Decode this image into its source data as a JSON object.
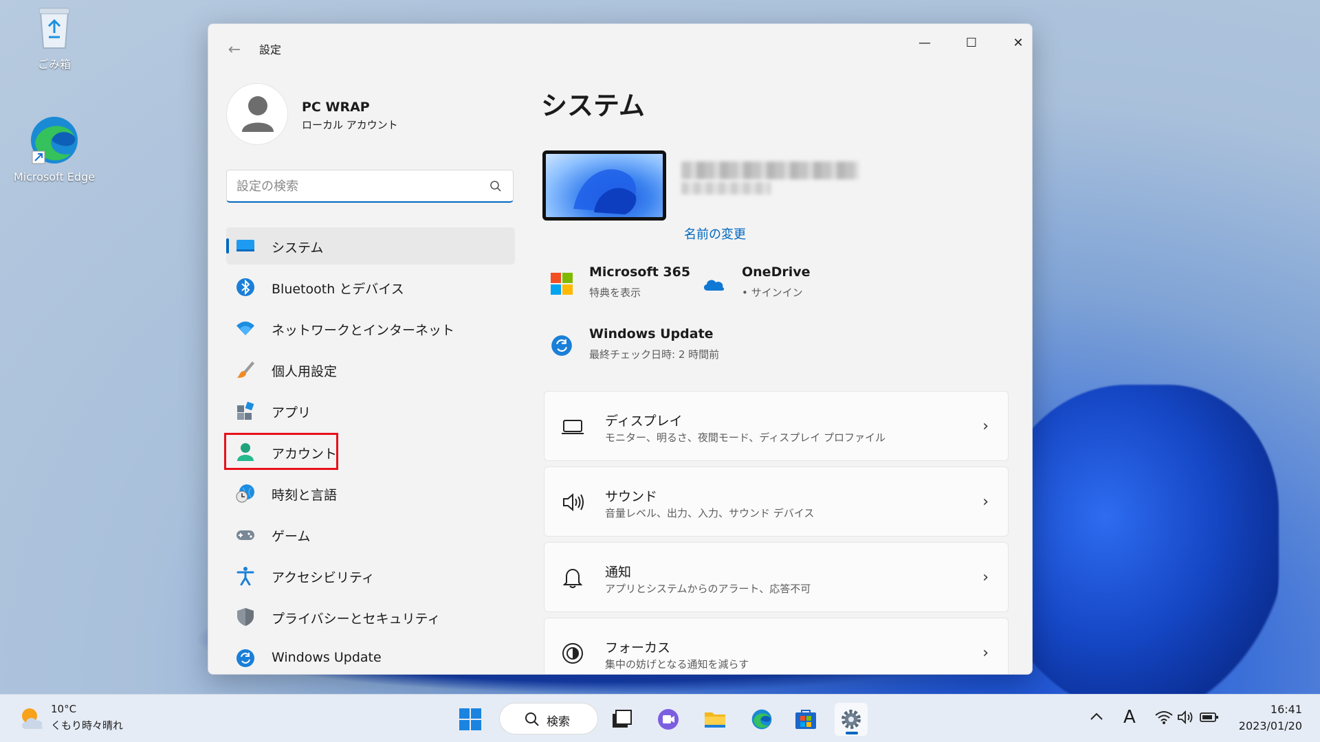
{
  "desktop": {
    "recycle_bin_label": "ごみ箱",
    "edge_label": "Microsoft Edge"
  },
  "window": {
    "title": "設定",
    "back": "←",
    "minimize": "—",
    "maximize": "☐",
    "close": "✕"
  },
  "profile": {
    "name": "PC WRAP",
    "account_type": "ローカル アカウント"
  },
  "search": {
    "placeholder": "設定の検索"
  },
  "nav": {
    "items": [
      {
        "label": "システム"
      },
      {
        "label": "Bluetooth とデバイス"
      },
      {
        "label": "ネットワークとインターネット"
      },
      {
        "label": "個人用設定"
      },
      {
        "label": "アプリ"
      },
      {
        "label": "アカウント"
      },
      {
        "label": "時刻と言語"
      },
      {
        "label": "ゲーム"
      },
      {
        "label": "アクセシビリティ"
      },
      {
        "label": "プライバシーとセキュリティ"
      },
      {
        "label": "Windows Update"
      }
    ]
  },
  "main": {
    "page_title": "システム",
    "rename_link": "名前の変更",
    "m365": {
      "title": "Microsoft 365",
      "subtitle": "特典を表示"
    },
    "onedrive": {
      "title": "OneDrive",
      "subtitle": "• サインイン"
    },
    "windows_update": {
      "title": "Windows Update",
      "subtitle": "最終チェック日時: 2 時間前"
    },
    "cards": [
      {
        "title": "ディスプレイ",
        "subtitle": "モニター、明るさ、夜間モード、ディスプレイ プロファイル"
      },
      {
        "title": "サウンド",
        "subtitle": "音量レベル、出力、入力、サウンド デバイス"
      },
      {
        "title": "通知",
        "subtitle": "アプリとシステムからのアラート、応答不可"
      },
      {
        "title": "フォーカス",
        "subtitle": "集中の妨げとなる通知を減らす"
      }
    ],
    "chevron": "›"
  },
  "taskbar": {
    "weather_temp": "10°C",
    "weather_cond": "くもり時々晴れ",
    "search_label": "検索",
    "ime": "A",
    "time": "16:41",
    "date": "2023/01/20"
  },
  "colors": {
    "accent": "#0067c0",
    "highlight": "#e8101a"
  }
}
